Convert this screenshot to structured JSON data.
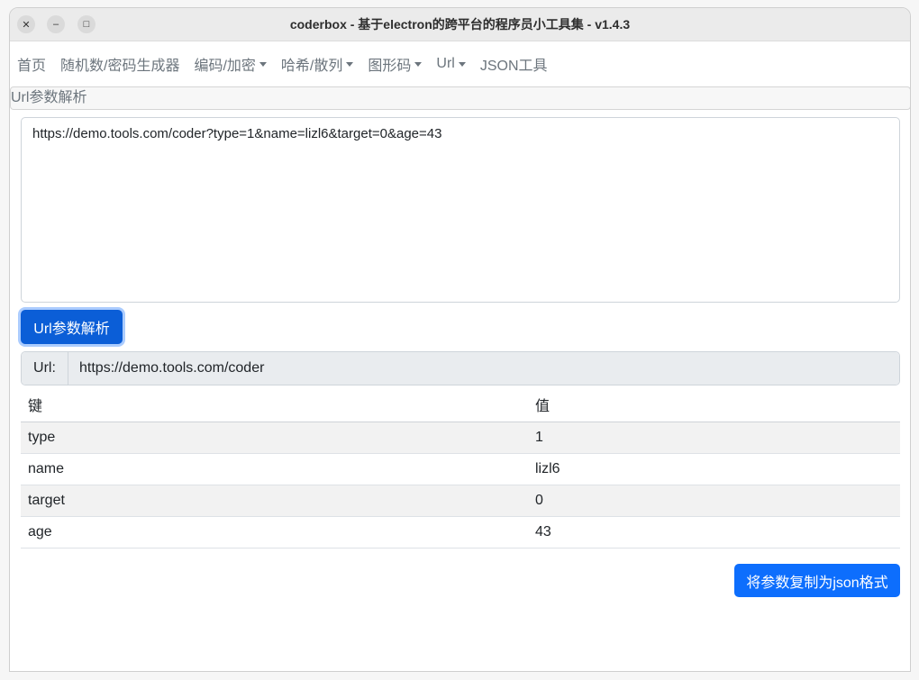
{
  "window": {
    "title": "coderbox - 基于electron的跨平台的程序员小工具集 - v1.4.3",
    "close_glyph": "✕",
    "min_glyph": "–",
    "max_glyph": "□"
  },
  "nav": {
    "items": [
      {
        "label": "首页",
        "dropdown": false
      },
      {
        "label": "随机数/密码生成器",
        "dropdown": false
      },
      {
        "label": "编码/加密",
        "dropdown": true
      },
      {
        "label": "哈希/散列",
        "dropdown": true
      },
      {
        "label": "图形码",
        "dropdown": true
      },
      {
        "label": "Url",
        "dropdown": true
      },
      {
        "label": "JSON工具",
        "dropdown": false
      }
    ]
  },
  "page": {
    "header": "Url参数解析",
    "input_value": "https://demo.tools.com/coder?type=1&name=lizl6&target=0&age=43",
    "parse_button": "Url参数解析",
    "url_label": "Url:",
    "url_value": "https://demo.tools.com/coder",
    "table": {
      "headers": [
        "键",
        "值"
      ],
      "rows": [
        [
          "type",
          "1"
        ],
        [
          "name",
          "lizl6"
        ],
        [
          "target",
          "0"
        ],
        [
          "age",
          "43"
        ]
      ]
    },
    "copy_json_button": "将参数复制为json格式"
  },
  "colors": {
    "primary": "#0d6efd",
    "primary_active": "#0b5ed7",
    "nav_text": "#6c757d"
  }
}
